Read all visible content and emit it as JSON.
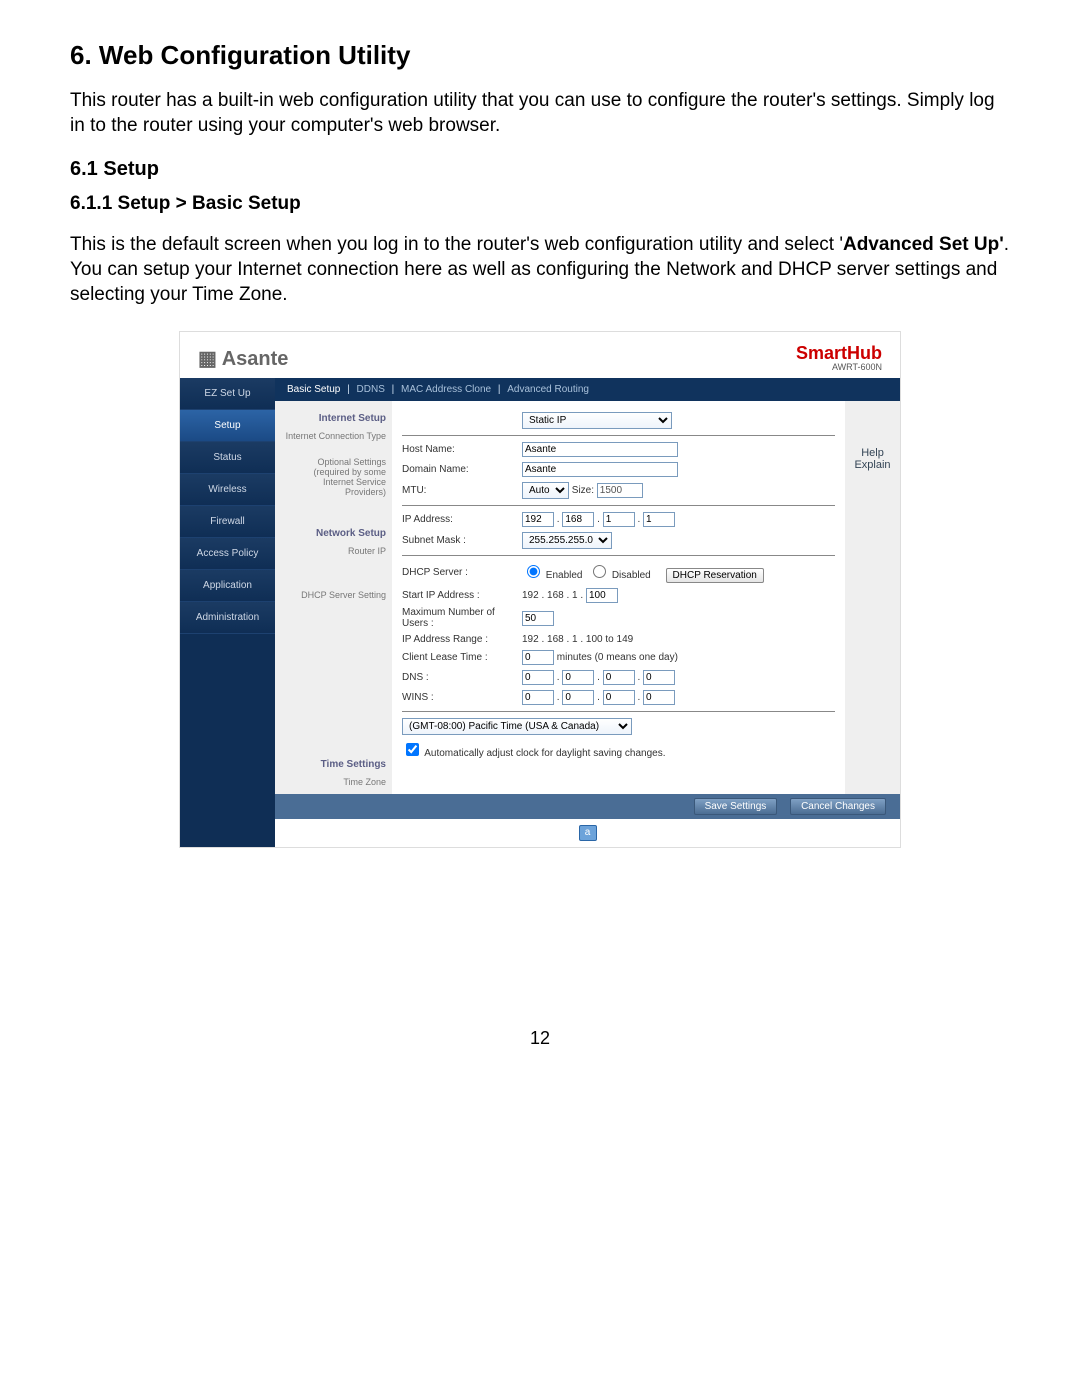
{
  "doc": {
    "h1": "6. Web Configuration Utility",
    "intro": "This router has a built-in web configuration utility that you can use to configure the router's settings. Simply log in to the router using your computer's web browser.",
    "h2": "6.1 Setup",
    "h3": "6.1.1 Setup > Basic Setup",
    "para2a": "This is the default screen when you log in to the router's web configuration utility and select '",
    "para2bold": "Advanced Set Up'",
    "para2b": ". You can setup your Internet connection here as well as configuring the Network and DHCP server settings and selecting your Time Zone.",
    "pagenum": "12"
  },
  "router": {
    "brand_left": "Asante",
    "brand_right": "SmartHub",
    "model": "AWRT-600N",
    "nav": [
      "EZ Set Up",
      "Setup",
      "Status",
      "Wireless",
      "Firewall",
      "Access Policy",
      "Application",
      "Administration"
    ],
    "nav_active_index": 1,
    "subnav": [
      "Basic Setup",
      "DDNS",
      "MAC Address Clone",
      "Advanced Routing"
    ],
    "help": "Help",
    "explain": "Explain",
    "sections": {
      "internet_setup": "Internet Setup",
      "conn_type_label": "Internet Connection Type",
      "conn_type_value": "Static IP",
      "optional_label": "Optional Settings (required by some Internet Service Providers)",
      "host_name_label": "Host Name:",
      "host_name_value": "Asante",
      "domain_name_label": "Domain Name:",
      "domain_name_value": "Asante",
      "mtu_label": "MTU:",
      "mtu_mode": "Auto",
      "mtu_size_label": "Size:",
      "mtu_size_value": "1500",
      "network_setup": "Network Setup",
      "router_ip_label": "Router IP",
      "ip_address_label": "IP Address:",
      "ip_octets": [
        "192",
        "168",
        "1",
        "1"
      ],
      "subnet_label": "Subnet Mask :",
      "subnet_value": "255.255.255.0",
      "dhcp_section": "DHCP Server Setting",
      "dhcp_server_label": "DHCP Server :",
      "dhcp_enabled": "Enabled",
      "dhcp_disabled": "Disabled",
      "dhcp_reservation": "DHCP Reservation",
      "start_ip_label": "Start IP Address :",
      "start_ip_prefix": "192 . 168 . 1 .",
      "start_ip_last": "100",
      "max_users_label": "Maximum Number of Users :",
      "max_users_value": "50",
      "ip_range_label": "IP Address Range :",
      "ip_range_value": "192 . 168 . 1 . 100 to 149",
      "lease_label": "Client Lease Time :",
      "lease_value": "0",
      "lease_suffix": "minutes (0 means one day)",
      "dns_label": "DNS :",
      "dns_octets": [
        "0",
        "0",
        "0",
        "0"
      ],
      "wins_label": "WINS :",
      "wins_octets": [
        "0",
        "0",
        "0",
        "0"
      ],
      "time_settings": "Time Settings",
      "time_zone_label": "Time Zone",
      "time_zone_value": "(GMT-08:00) Pacific Time (USA & Canada)",
      "dst_label": "Automatically adjust clock for daylight saving changes."
    },
    "buttons": {
      "save": "Save Settings",
      "cancel": "Cancel Changes"
    }
  }
}
